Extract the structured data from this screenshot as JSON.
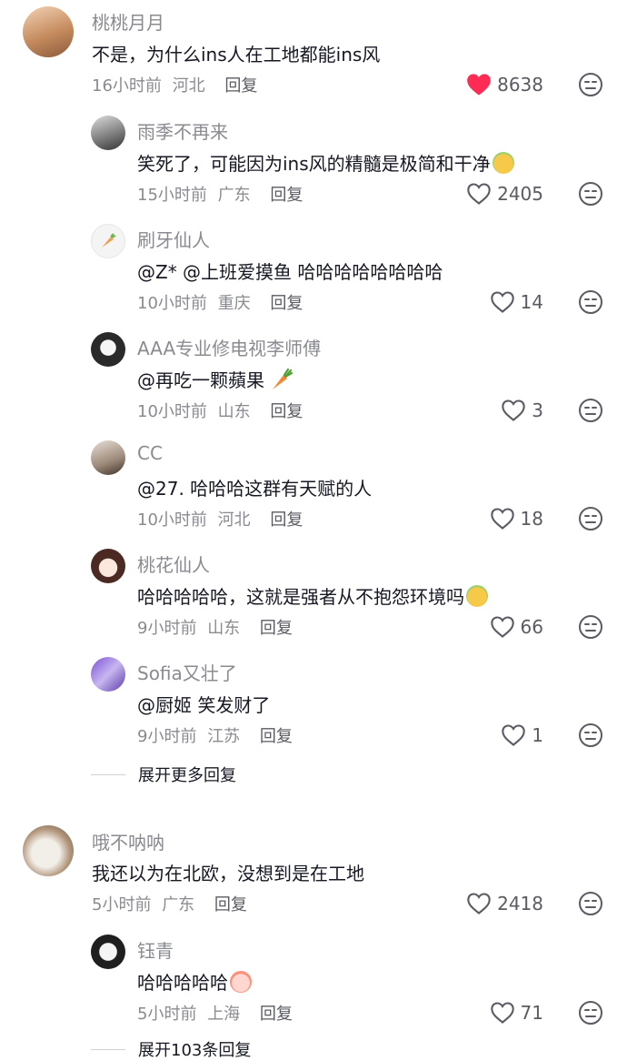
{
  "comments": [
    {
      "name": "桃桃月月",
      "text": "不是，为什么ins人在工地都能ins风",
      "time": "16小时前",
      "location": "河北",
      "reply_label": "回复",
      "likes": "8638",
      "liked": true,
      "replies": [
        {
          "name": "雨季不再来",
          "text": "笑死了，可能因为ins风的精髓是极简和干净",
          "time": "15小时前",
          "location": "广东",
          "reply_label": "回复",
          "likes": "2405"
        },
        {
          "name": "刷牙仙人",
          "text": "@Z* @上班爱摸鱼 哈哈哈哈哈哈哈哈",
          "time": "10小时前",
          "location": "重庆",
          "reply_label": "回复",
          "likes": "14"
        },
        {
          "name": "AAA专业修电视李师傅",
          "text": "@再吃一颗蘋果",
          "time": "10小时前",
          "location": "山东",
          "reply_label": "回复",
          "likes": "3"
        },
        {
          "name": "CC",
          "text": "@27.  哈哈哈这群有天赋的人",
          "time": "10小时前",
          "location": "河北",
          "reply_label": "回复",
          "likes": "18"
        },
        {
          "name": "桃花仙人",
          "text": "哈哈哈哈哈，这就是强者从不抱怨环境吗",
          "time": "9小时前",
          "location": "山东",
          "reply_label": "回复",
          "likes": "66"
        },
        {
          "name": "Sofia又壮了",
          "text": "@厨姬 笑发财了",
          "time": "9小时前",
          "location": "江苏",
          "reply_label": "回复",
          "likes": "1"
        }
      ],
      "expand_label": "展开更多回复"
    },
    {
      "name": "哦不呐呐",
      "text": "我还以为在北欧，没想到是在工地",
      "time": "5小时前",
      "location": "广东",
      "reply_label": "回复",
      "likes": "2418",
      "liked": false,
      "replies": [
        {
          "name": "钰青",
          "text": "哈哈哈哈哈",
          "time": "5小时前",
          "location": "上海",
          "reply_label": "回复",
          "likes": "71"
        }
      ],
      "expand_label": "展开103条回复"
    }
  ],
  "colors": {
    "like_active": "#fe2c55",
    "secondary_text": "#8a8b91",
    "primary_text": "#161823"
  },
  "icons": [
    "heart-filled-icon",
    "heart-outline-icon",
    "dislike-face-icon",
    "carrot-emoji",
    "laughing-face-emoji",
    "crying-laugh-emoji"
  ]
}
